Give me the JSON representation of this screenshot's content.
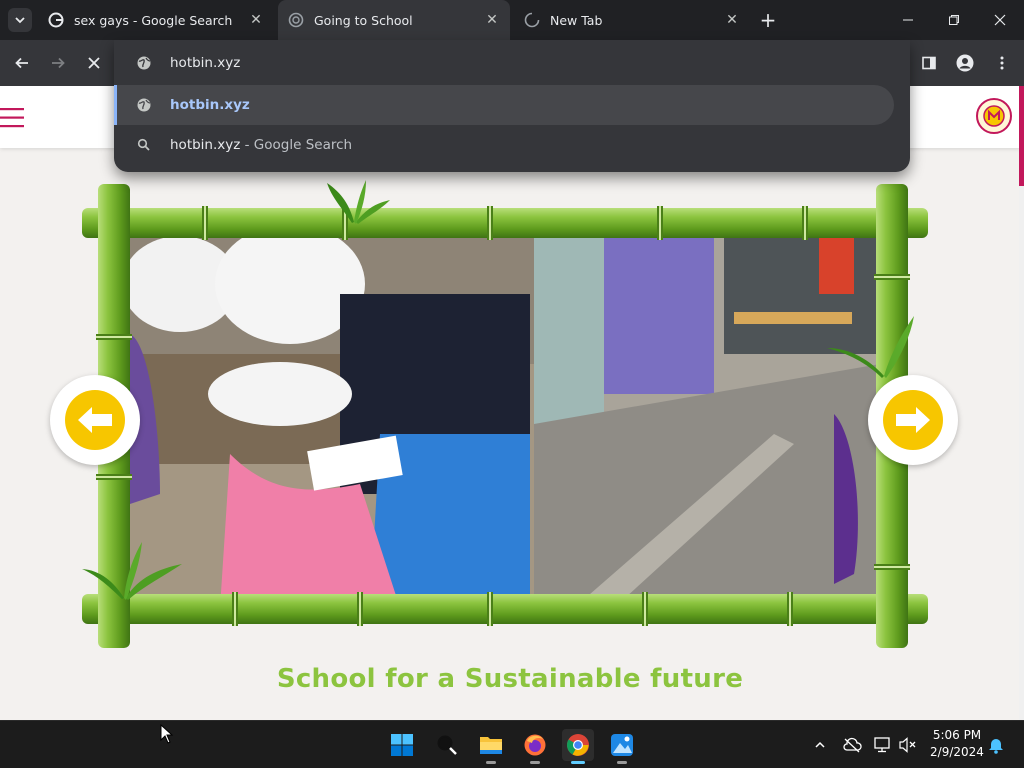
{
  "browser": {
    "tabs": [
      {
        "title": "sex gays - Google Search",
        "favicon": "google-icon",
        "active": false
      },
      {
        "title": "Going to School",
        "favicon": "site-icon",
        "active": true
      },
      {
        "title": "New Tab",
        "favicon": "loading-spinner-icon",
        "active": false
      }
    ],
    "new_tab_label": "+",
    "window_controls": [
      "minimize-icon",
      "restore-icon",
      "close-icon"
    ],
    "omnibox": {
      "value": "hotbin.xyz",
      "suggestions": [
        {
          "text": "hotbin.xyz",
          "suffix": "",
          "icon": "globe-icon",
          "selected": true
        },
        {
          "text": "hotbin.xyz",
          "suffix": " - Google Search",
          "icon": "search-icon",
          "selected": false
        }
      ]
    }
  },
  "page": {
    "tagline": "School for a Sustainable future",
    "colors": {
      "accent": "#c2185b",
      "tagline": "#8cc43f",
      "arrow": "#f7c600"
    }
  },
  "taskbar": {
    "apps": [
      "windows-start-icon",
      "search-icon",
      "file-explorer-icon",
      "firefox-icon",
      "chrome-icon",
      "photos-icon"
    ],
    "clock": {
      "time": "5:06 PM",
      "date": "2/9/2024"
    }
  }
}
